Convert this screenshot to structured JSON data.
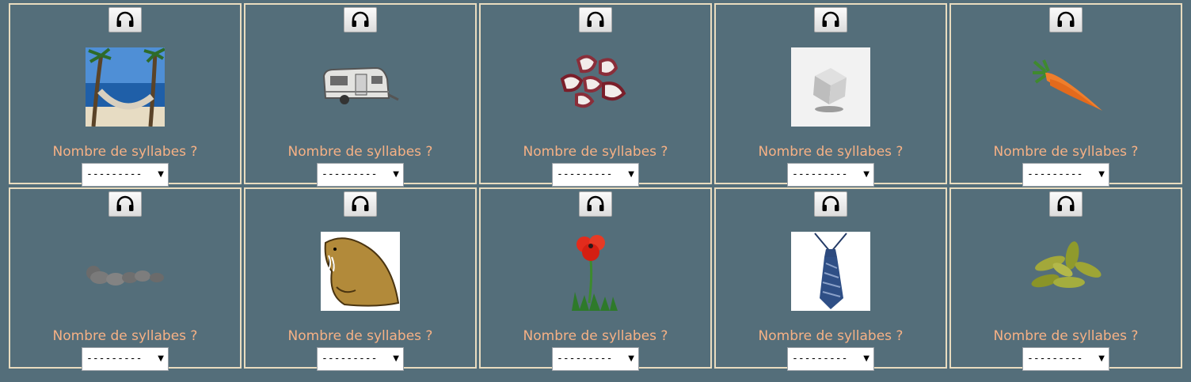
{
  "question_label": "Nombre de syllabes ?",
  "select_value": "---------",
  "items": [
    {
      "icon": "hammock-image"
    },
    {
      "icon": "caravan-image"
    },
    {
      "icon": "octopus-pieces-image"
    },
    {
      "icon": "cube-image"
    },
    {
      "icon": "carrot-image"
    },
    {
      "icon": "pebbles-image"
    },
    {
      "icon": "walrus-image"
    },
    {
      "icon": "poppy-image"
    },
    {
      "icon": "necktie-image"
    },
    {
      "icon": "pickles-image"
    }
  ],
  "colors": {
    "background": "#546e7a",
    "border": "#e9dcbf",
    "question": "#f6b185"
  }
}
